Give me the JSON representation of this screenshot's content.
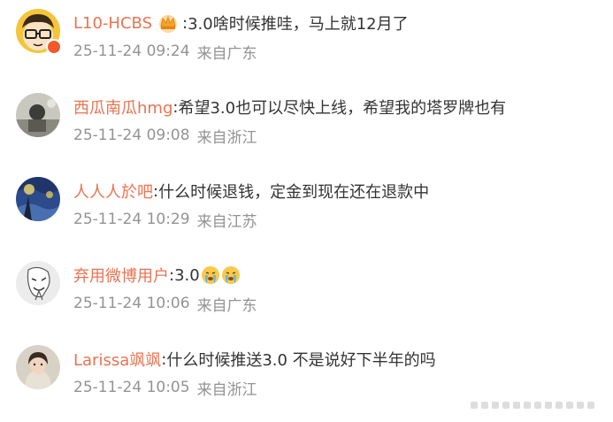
{
  "comments": [
    {
      "username": "L10-HCBS",
      "separator": ":",
      "text": "3.0啥时候推哇，马上就12月了",
      "date": "25-11-24 09:24",
      "location": "来自广东",
      "avatar_icon": "cartoon-glasses-avatar",
      "user_badge_icon": "crown-icon"
    },
    {
      "username": "西瓜南瓜hmg",
      "separator": ":",
      "text": "希望3.0也可以尽快上线，希望我的塔罗牌也有",
      "date": "25-11-24 09:08",
      "location": "来自浙江",
      "avatar_icon": "photo-avatar"
    },
    {
      "username": "人人人於吧",
      "separator": ":",
      "text": "什么时候退钱，定金到现在还在退款中",
      "date": "25-11-24 10:29",
      "location": "来自江苏",
      "avatar_icon": "starry-night-avatar"
    },
    {
      "username": "弃用微博用户",
      "separator": ":",
      "text": "3.0",
      "trailing_icons": [
        "crying-emoji-icon",
        "crying-emoji-icon"
      ],
      "date": "25-11-24 10:06",
      "location": "来自广东",
      "avatar_icon": "rage-face-avatar"
    },
    {
      "username": "Larissa飒飒",
      "separator": ":",
      "text": "什么时候推送3.0 不是说好下半年的吗",
      "date": "25-11-24 10:05",
      "location": "来自浙江",
      "avatar_icon": "girl-photo-avatar"
    }
  ],
  "colors": {
    "username": "#eb7350",
    "text": "#333333",
    "meta": "#939393",
    "background": "#ffffff"
  }
}
